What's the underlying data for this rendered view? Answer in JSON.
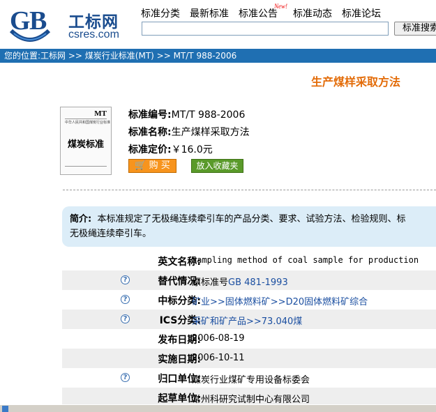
{
  "header": {
    "logo_cn": "工标网",
    "logo_en": "csres.com",
    "nav": [
      "标准分类",
      "最新标准",
      "标准公告",
      "标准动态",
      "标准论坛"
    ],
    "new_badge": "New!",
    "search_button": "标准搜索"
  },
  "breadcrumb": "您的位置:工标网 >> 煤炭行业标准(MT) >> MT/T 988-2006",
  "page_title": "生产煤样采取方法",
  "cover": {
    "code": "MT",
    "small_text": "中华人民共和国煤炭行业标准",
    "big_text": "煤炭标准"
  },
  "info": {
    "number_label": "标准编号:",
    "number_value": "MT/T 988-2006",
    "name_label": "标准名称:",
    "name_value": "生产煤样采取方法",
    "price_label": "标准定价:",
    "price_value": "￥16.0元"
  },
  "buttons": {
    "buy": "购 买",
    "favorite": "放入收藏夹"
  },
  "summary": {
    "label": "简介:",
    "text": "本标准规定了无极绳连续牵引车的产品分类、要求、试验方法、检验规则、标",
    "text2": "无极绳连续牵引车。"
  },
  "details": [
    {
      "key": "英文名称:",
      "value": "Sampling method of coal sample for production",
      "help": false
    },
    {
      "key": "替代情况:",
      "value_prefix": "原标准号",
      "value_link": "GB 481-1993",
      "help": true
    },
    {
      "key": "中标分类:",
      "value_link": "矿业>>固体燃料矿>>D20固体燃料矿综合",
      "help": true
    },
    {
      "key": "ICS分类:",
      "value_link": "采矿和矿产品>>73.040煤",
      "help": true
    },
    {
      "key": "发布日期:",
      "value": "2006-08-19",
      "help": false
    },
    {
      "key": "实施日期:",
      "value": "2006-10-11",
      "help": false
    },
    {
      "key": "归口单位:",
      "value": "煤炭行业煤矿专用设备标委会",
      "help": true
    },
    {
      "key": "起草单位:",
      "value": "常州科研究试制中心有限公司",
      "help": false
    }
  ],
  "colors": {
    "accent_blue": "#1f6fb2",
    "title_orange": "#e36c09",
    "buy_orange": "#f7941d",
    "fav_green": "#5a9a2a",
    "summary_bg": "#dcedf8"
  }
}
